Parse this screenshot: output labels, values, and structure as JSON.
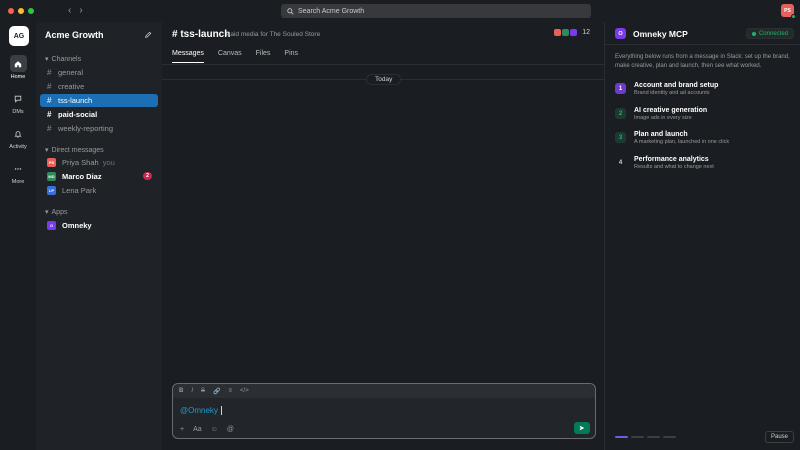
{
  "titlebar": {
    "search_placeholder": "Search Acme Growth",
    "user_initials": "PS",
    "traffic_colors": [
      "#ff5f57",
      "#febc2e",
      "#28c840"
    ]
  },
  "rail": {
    "workspace_initials": "AG",
    "items": [
      {
        "label": "Home",
        "icon": "home-icon"
      },
      {
        "label": "DMs",
        "icon": "chat-icon"
      },
      {
        "label": "Activity",
        "icon": "bell-icon"
      },
      {
        "label": "More",
        "icon": "more-icon"
      }
    ]
  },
  "sidebar": {
    "workspace_name": "Acme Growth",
    "channels_header": "Channels",
    "channels": [
      {
        "name": "general",
        "state": "normal"
      },
      {
        "name": "creative",
        "state": "normal"
      },
      {
        "name": "tss-launch",
        "state": "active"
      },
      {
        "name": "paid-social",
        "state": "bold"
      },
      {
        "name": "weekly-reporting",
        "state": "normal"
      }
    ],
    "dm_header": "Direct messages",
    "dms": [
      {
        "name": "Priya Shah",
        "initials": "PS",
        "color": "#e8605a",
        "suffix": "you",
        "state": "normal"
      },
      {
        "name": "Marco Diaz",
        "initials": "MD",
        "color": "#2f8a5b",
        "badge": "2",
        "state": "bold"
      },
      {
        "name": "Lena Park",
        "initials": "LP",
        "color": "#3b6fd8",
        "state": "normal"
      }
    ],
    "apps_header": "Apps",
    "apps": [
      {
        "name": "Omneky",
        "initials": "O",
        "color": "#7c3aed"
      }
    ]
  },
  "channel": {
    "title": "# tss-launch",
    "description": "Paid media for The Souled Store",
    "member_count": "12",
    "member_colors": [
      "#e8605a",
      "#2f8a5b",
      "#7c3aed"
    ],
    "tabs": [
      "Messages",
      "Canvas",
      "Files",
      "Pins"
    ],
    "active_tab": "Messages",
    "date_divider": "Today"
  },
  "composer": {
    "format_buttons": [
      "B",
      "I",
      "S",
      "🔗",
      "≡",
      "</>"
    ],
    "text": "@Omneky",
    "tools": [
      "+",
      "Aa",
      "☺",
      "@"
    ]
  },
  "panel": {
    "app_initial": "O",
    "title": "Omneky MCP",
    "status": "Connected",
    "intro": "Everything below runs from a message in Slack: set up the brand, make creative, plan and launch, then see what worked.",
    "steps": [
      {
        "num": "1",
        "title": "Account and brand setup",
        "sub": "Brand identity and ad accounts"
      },
      {
        "num": "2",
        "title": "AI creative generation",
        "sub": "Image ads in every size"
      },
      {
        "num": "3",
        "title": "Plan and launch",
        "sub": "A marketing plan, launched in one click"
      },
      {
        "num": "4",
        "title": "Performance analytics",
        "sub": "Results and what to change next"
      }
    ],
    "progress_total": 4,
    "progress_current": 1,
    "pause_label": "Pause"
  }
}
